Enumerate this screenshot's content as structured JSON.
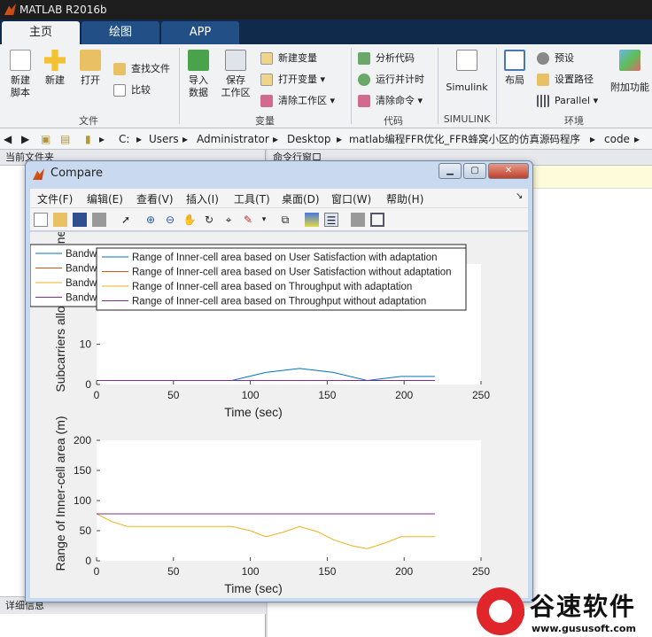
{
  "app": {
    "title": "MATLAB R2016b"
  },
  "tabs": [
    "主页",
    "绘图",
    "APP"
  ],
  "ribbon": {
    "new_script": "新建\n脚本",
    "new": "新建",
    "open": "打开",
    "find_files": "查找文件",
    "compare": "比较",
    "import_data": "导入\n数据",
    "save_workspace": "保存\n工作区",
    "new_var": "新建变量",
    "open_var": "打开变量",
    "clear_workspace": "清除工作区",
    "analyze_code": "分析代码",
    "run_timing": "运行并计时",
    "clear_commands": "清除命令",
    "simulink": "Simulink",
    "layout": "布局",
    "preferences": "预设",
    "set_path": "设置路径",
    "parallel": "Parallel",
    "addons": "附加功能",
    "group_file": "文件",
    "group_variable": "变量",
    "group_code": "代码",
    "group_simulink": "SIMULINK",
    "group_env": "环境"
  },
  "address": [
    "C:",
    "Users",
    "Administrator",
    "Desktop",
    "matlab编程FFR优化_FFR蜂窝小区的仿真源码程序",
    "code"
  ],
  "panels": {
    "current_folder": "当前文件夹",
    "command_window": "命令行窗口",
    "details": "详细信息"
  },
  "figure_window": {
    "title": "Compare",
    "menu": [
      "文件(F)",
      "编辑(E)",
      "查看(V)",
      "插入(I)",
      "工具(T)",
      "桌面(D)",
      "窗口(W)",
      "帮助(H)"
    ]
  },
  "chart_data": [
    {
      "type": "line",
      "xlabel": "Time (sec)",
      "ylabel": "Subcarriers allocated for Inner-cell",
      "xlim": [
        0,
        250
      ],
      "ylim": [
        0,
        30
      ],
      "xticks": [
        0,
        50,
        100,
        150,
        200,
        250
      ],
      "yticks": [
        0,
        10,
        30
      ],
      "legend": "top-left",
      "series": [
        {
          "name": "Bandwidth allocation of Inner-cell area based on User Satisfaction with adaptation",
          "color": "#0072bd",
          "x": [
            0,
            88,
            110,
            132,
            154,
            176,
            198,
            220
          ],
          "y": [
            1,
            1,
            3,
            4,
            3,
            1,
            2,
            2
          ]
        },
        {
          "name": "Bandwidth allocation of Inner-cell area based on User Satisfaction without adaptation",
          "color": "#d95319",
          "x": [
            0,
            220
          ],
          "y": [
            1,
            1
          ]
        },
        {
          "name": "Bandwidth allocation of Inner-cell area based on Throughput with adaptation",
          "color": "#edb120",
          "x": [
            0,
            220
          ],
          "y": [
            1,
            1
          ]
        },
        {
          "name": "Bandwidth allocation of Inner-cell area based on Throughput without adaptation",
          "color": "#7e2f8e",
          "x": [
            0,
            220
          ],
          "y": [
            1,
            1
          ]
        }
      ]
    },
    {
      "type": "line",
      "xlabel": "Time (sec)",
      "ylabel": "Range of Inner-cell area (m)",
      "xlim": [
        0,
        250
      ],
      "ylim": [
        0,
        200
      ],
      "xticks": [
        0,
        50,
        100,
        150,
        200,
        250
      ],
      "yticks": [
        0,
        50,
        100,
        150,
        200
      ],
      "legend": "top-left",
      "series": [
        {
          "name": "Range of Inner-cell area based on User Satisfaction with adaptation",
          "color": "#0072bd",
          "x": [
            0,
            220
          ],
          "y": [
            78,
            78
          ]
        },
        {
          "name": "Range of Inner-cell area based on User Satisfaction without adaptation",
          "color": "#d95319",
          "x": [
            0,
            220
          ],
          "y": [
            78,
            78
          ]
        },
        {
          "name": "Range of Inner-cell area based on Throughput with adaptation",
          "color": "#edb120",
          "x": [
            0,
            10,
            20,
            40,
            66,
            88,
            100,
            110,
            122,
            132,
            144,
            154,
            166,
            176,
            188,
            198,
            220
          ],
          "y": [
            78,
            65,
            57,
            57,
            57,
            57,
            50,
            40,
            48,
            57,
            48,
            35,
            25,
            20,
            30,
            40,
            40
          ]
        },
        {
          "name": "Range of Inner-cell area based on Throughput without adaptation",
          "color": "#7e2f8e",
          "x": [
            0,
            220
          ],
          "y": [
            78,
            78
          ]
        }
      ]
    }
  ],
  "watermark": {
    "brand": "谷速软件",
    "url": "www.gususoft.com"
  }
}
